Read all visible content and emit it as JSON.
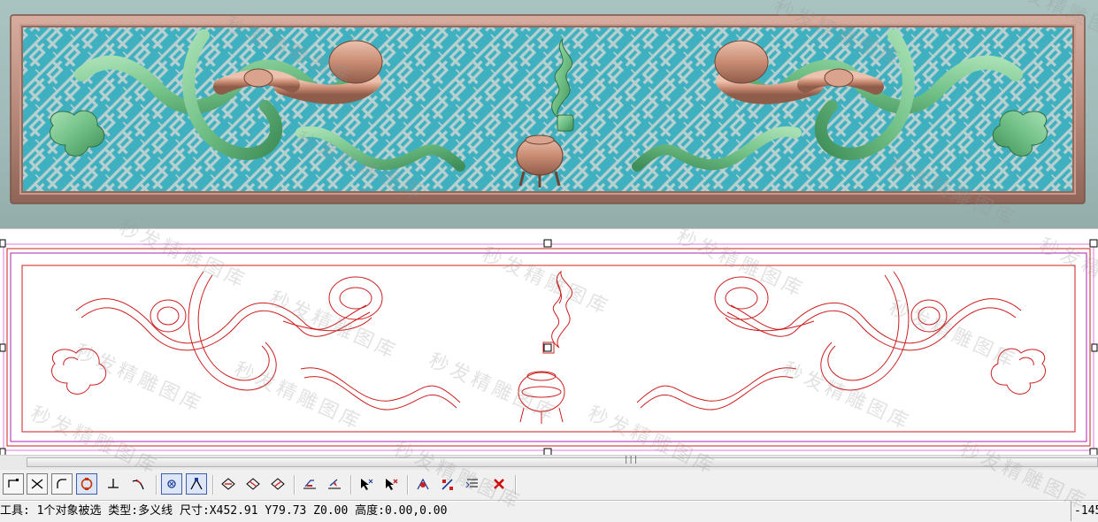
{
  "watermark": {
    "text": "秒发精雕图库"
  },
  "scrollbar": {
    "grip": "|||"
  },
  "toolbar": {
    "buttons": [
      {
        "id": "polyline-corner",
        "icon": "corner-icon"
      },
      {
        "id": "trim",
        "icon": "cross-cut-icon"
      },
      {
        "id": "arc-fillet",
        "icon": "arc-corner-icon"
      },
      {
        "id": "snap-circle",
        "icon": "circle-snap-icon"
      },
      {
        "id": "perpendicular",
        "icon": "perpendicular-icon"
      },
      {
        "id": "tangent",
        "icon": "tangent-icon"
      },
      {
        "id": "node-select",
        "icon": "node-icon"
      },
      {
        "id": "node-edit",
        "icon": "node-edit-icon"
      },
      {
        "id": "diamond-1",
        "icon": "diamond-node-icon"
      },
      {
        "id": "diamond-2",
        "icon": "diamond-node-icon"
      },
      {
        "id": "diamond-3",
        "icon": "diamond-node-icon"
      },
      {
        "id": "align-1",
        "icon": "align-icon"
      },
      {
        "id": "align-2",
        "icon": "align-arrow-icon"
      },
      {
        "id": "select-arrow",
        "icon": "arrow-select-icon"
      },
      {
        "id": "select-arrow-red",
        "icon": "arrow-delete-icon"
      },
      {
        "id": "node-tool-1",
        "icon": "node-tool-icon"
      },
      {
        "id": "node-tool-2",
        "icon": "pen-node-icon"
      },
      {
        "id": "list-edit",
        "icon": "list-edit-icon"
      },
      {
        "id": "delete",
        "icon": "delete-x-icon"
      }
    ]
  },
  "status_bar": {
    "message": "工具: 1个对象被选 类型:多义线 尺寸:X452.91 Y79.73 Z0.00 高度:0.00,0.00",
    "coordinate": "-145"
  },
  "colors": {
    "drawing_line": "#cc1f1f",
    "selection_box": "#b020b0",
    "relief_background": "#3fb0bf",
    "relief_frame": "#b9897a",
    "relief_green": "#6fbf85",
    "relief_copper": "#c98c73"
  }
}
